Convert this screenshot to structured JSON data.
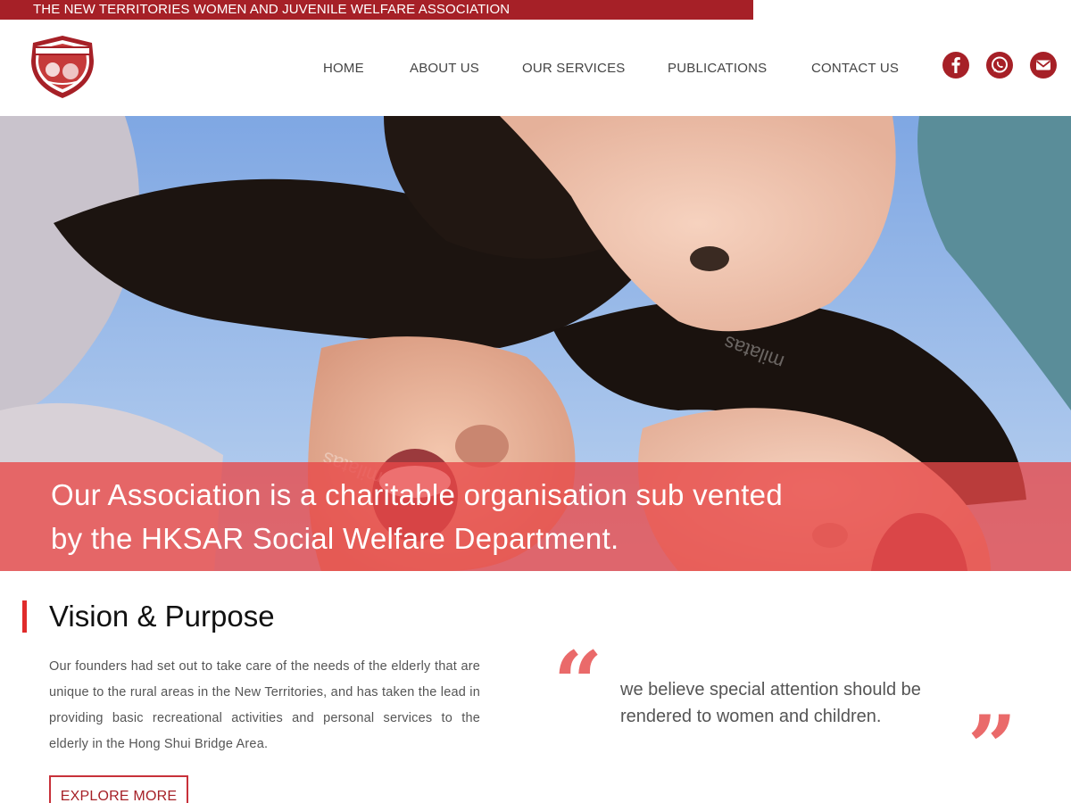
{
  "topbar": {
    "title": "THE NEW TERRITORIES WOMEN AND JUVENILE WELFARE ASSOCIATION"
  },
  "header": {
    "logo": "association-crest-logo",
    "nav": [
      {
        "label": "HOME"
      },
      {
        "label": "ABOUT US"
      },
      {
        "label": "OUR SERVICES"
      },
      {
        "label": "PUBLICATIONS"
      },
      {
        "label": "CONTACT US"
      }
    ],
    "social": [
      {
        "icon": "facebook-icon"
      },
      {
        "icon": "whatsapp-icon"
      },
      {
        "icon": "mail-icon"
      }
    ]
  },
  "hero": {
    "image": "children-smiling-photo",
    "banner_line1": "Our Association is a charitable organisation sub vented",
    "banner_line2": "by the HKSAR Social Welfare Department."
  },
  "vision": {
    "title": "Vision & Purpose",
    "body": "Our founders had set out to take care of the needs of the elderly that are unique to the rural areas in the New Territories, and has taken the lead in providing basic recreational activities and personal services to the elderly in the Hong Shui Bridge Area.",
    "button": "EXPLORE MORE",
    "quote_open": "“",
    "quote_close": "”",
    "quote": "we believe special attention should be rendered to women and children."
  },
  "colors": {
    "brand": "#a62027",
    "accent": "#e02b2b",
    "banner": "#e84848",
    "quote": "#ea6a6a"
  }
}
